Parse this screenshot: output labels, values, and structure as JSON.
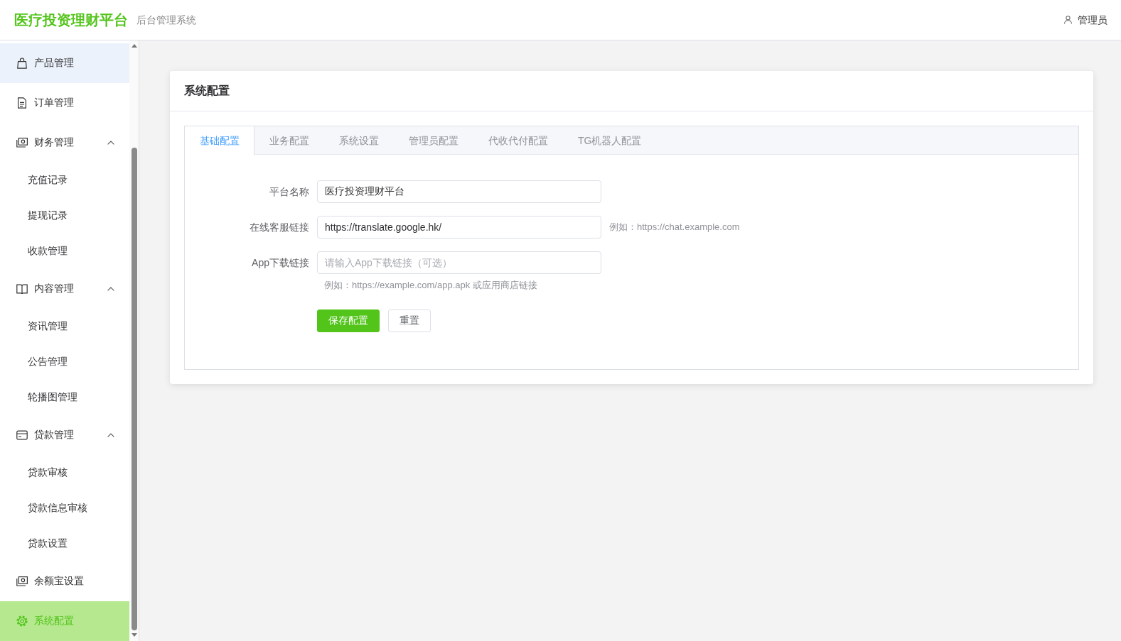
{
  "header": {
    "logo": "医疗投资理财平台",
    "subtitle": "后台管理系统",
    "user": "管理员"
  },
  "sidebar": {
    "items": [
      {
        "label": "产品管理",
        "hovered": true,
        "selected": false
      },
      {
        "label": "订单管理",
        "hovered": false,
        "selected": false
      },
      {
        "label": "财务管理",
        "hovered": false,
        "selected": false,
        "expanded": true,
        "children": [
          {
            "label": "充值记录",
            "hovered": false,
            "selected": false
          },
          {
            "label": "提现记录",
            "hovered": false,
            "selected": false
          },
          {
            "label": "收款管理",
            "hovered": false,
            "selected": false
          }
        ]
      },
      {
        "label": "内容管理",
        "hovered": false,
        "selected": false,
        "expanded": true,
        "children": [
          {
            "label": "资讯管理",
            "hovered": false,
            "selected": false
          },
          {
            "label": "公告管理",
            "hovered": false,
            "selected": false
          },
          {
            "label": "轮播图管理",
            "hovered": false,
            "selected": false
          }
        ]
      },
      {
        "label": "贷款管理",
        "hovered": false,
        "selected": false,
        "expanded": true,
        "children": [
          {
            "label": "贷款审核",
            "hovered": false,
            "selected": false
          },
          {
            "label": "贷款信息审核",
            "hovered": false,
            "selected": false
          },
          {
            "label": "贷款设置",
            "hovered": false,
            "selected": false
          }
        ]
      },
      {
        "label": "余额宝设置",
        "hovered": false,
        "selected": false
      },
      {
        "label": "系统配置",
        "hovered": false,
        "selected": true
      }
    ]
  },
  "card": {
    "title": "系统配置",
    "tabs": [
      {
        "label": "基础配置",
        "selected": true
      },
      {
        "label": "业务配置",
        "selected": false
      },
      {
        "label": "系统设置",
        "selected": false
      },
      {
        "label": "管理员配置",
        "selected": false
      },
      {
        "label": "代收代付配置",
        "selected": false
      },
      {
        "label": "TG机器人配置",
        "selected": false
      }
    ],
    "form": {
      "fields": [
        {
          "label": "平台名称",
          "value": "医疗投资理财平台"
        },
        {
          "label": "在线客服链接",
          "value": "https://translate.google.hk/",
          "hint": "例如：https://chat.example.com"
        },
        {
          "label": "App下载链接",
          "placeholder": "请输入App下载链接（可选）",
          "help": "例如：https://example.com/app.apk 或应用商店链接"
        }
      ],
      "buttons": [
        {
          "label": "保存配置",
          "kind": "primary"
        },
        {
          "label": "重置",
          "kind": "default"
        }
      ]
    }
  }
}
